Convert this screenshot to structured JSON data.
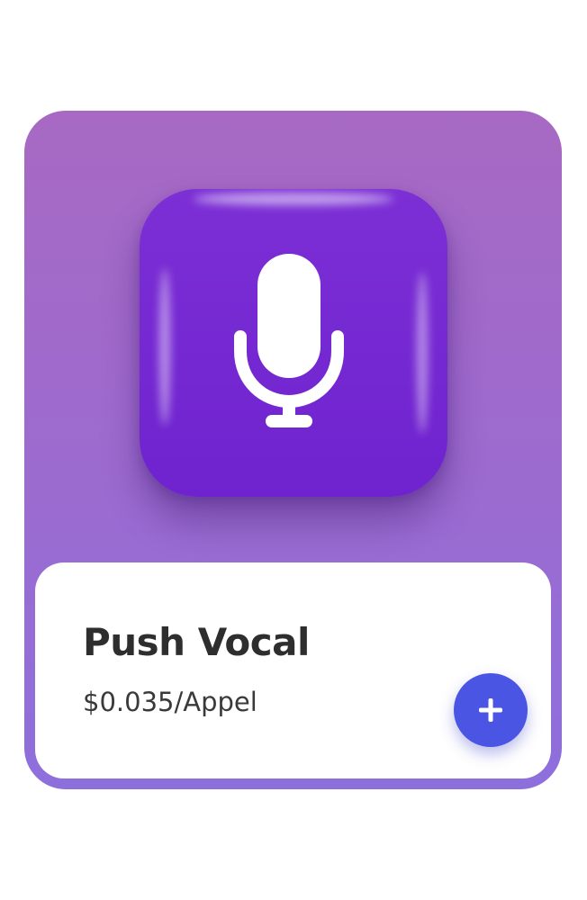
{
  "product": {
    "name": "Push Vocal",
    "price": "$0.035/Appel",
    "icon": "microphone-icon",
    "add_icon": "plus-icon"
  },
  "colors": {
    "card_gradient_top": "#a769c3",
    "card_gradient_bottom": "#8d6fdc",
    "icon_tile": "#7c2fd5",
    "add_button": "#4a56e3",
    "title_text": "#2e2e2e"
  }
}
